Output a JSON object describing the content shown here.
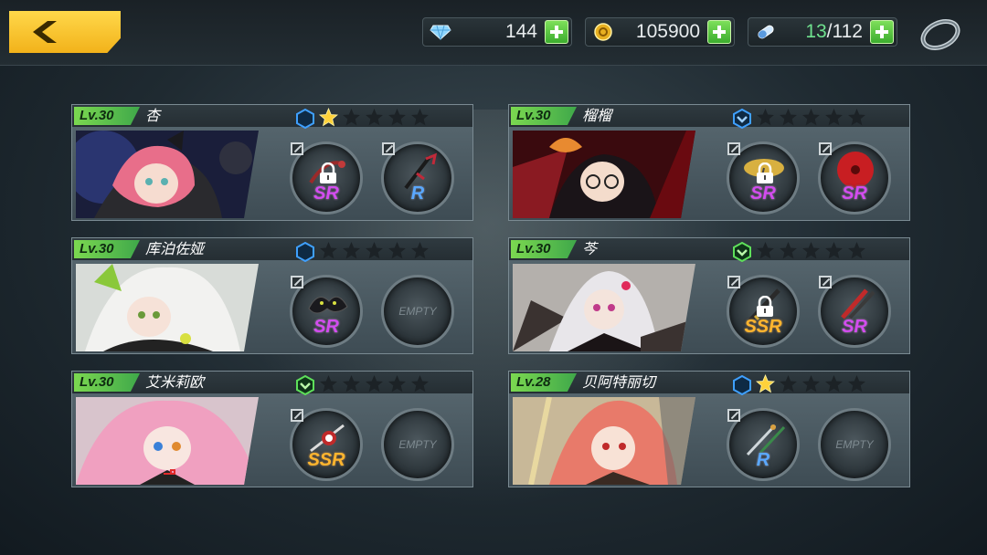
{
  "resources": {
    "gems": "144",
    "coins": "105900",
    "stamina_current": "13",
    "stamina_max": "/112"
  },
  "colors": {
    "accent_yellow": "#f2b21a",
    "level_green": "#5cc84e",
    "sr_purple": "#d34cf0",
    "ssr_gold": "#ffb52e",
    "r_blue": "#5aa8ff"
  },
  "cards": [
    {
      "level": "Lv.30",
      "name": "杏",
      "grade": "blue",
      "stars": 1,
      "slots": [
        {
          "rarity": "SR",
          "locked": true,
          "empty": false
        },
        {
          "rarity": "R",
          "locked": false,
          "empty": false
        }
      ]
    },
    {
      "level": "Lv.30",
      "name": "榴榴",
      "grade": "blue-chevron",
      "stars": 0,
      "slots": [
        {
          "rarity": "SR",
          "locked": true,
          "empty": false
        },
        {
          "rarity": "SR",
          "locked": false,
          "empty": false
        }
      ]
    },
    {
      "level": "Lv.30",
      "name": "库泊佐娅",
      "grade": "blue",
      "stars": 0,
      "slots": [
        {
          "rarity": "SR",
          "locked": false,
          "empty": false
        },
        {
          "rarity": "EMPTY",
          "locked": false,
          "empty": true
        }
      ]
    },
    {
      "level": "Lv.30",
      "name": "芩",
      "grade": "green-chevron",
      "stars": 0,
      "slots": [
        {
          "rarity": "SSR",
          "locked": true,
          "empty": false
        },
        {
          "rarity": "SR",
          "locked": false,
          "empty": false
        }
      ]
    },
    {
      "level": "Lv.30",
      "name": "艾米莉欧",
      "grade": "green-chevron",
      "stars": 0,
      "slots": [
        {
          "rarity": "SSR",
          "locked": false,
          "empty": false
        },
        {
          "rarity": "EMPTY",
          "locked": false,
          "empty": true
        }
      ]
    },
    {
      "level": "Lv.28",
      "name": "贝阿特丽切",
      "grade": "blue",
      "stars": 1,
      "slots": [
        {
          "rarity": "R",
          "locked": false,
          "empty": false
        },
        {
          "rarity": "EMPTY",
          "locked": false,
          "empty": true
        }
      ]
    }
  ]
}
